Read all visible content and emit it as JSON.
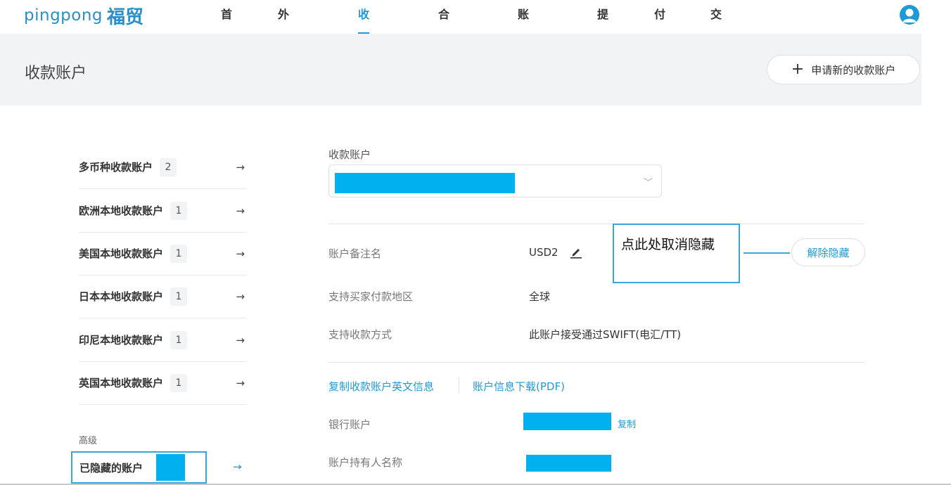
{
  "header": {
    "logo_en": "pingpong",
    "logo_cn": "福贸",
    "nav": [
      {
        "label": "首页"
      },
      {
        "label": "外贸收款"
      },
      {
        "label": "收款账户",
        "active": true
      },
      {
        "label": "合同订单"
      },
      {
        "label": "账单管理"
      },
      {
        "label": "提现"
      },
      {
        "label": "付款"
      },
      {
        "label": "交易查询"
      }
    ]
  },
  "page": {
    "title": "收款账户",
    "apply_button": "申请新的收款账户"
  },
  "sidebar": {
    "items": [
      {
        "label": "多币种收款账户",
        "count": "2"
      },
      {
        "label": "欧洲本地收款账户",
        "count": "1"
      },
      {
        "label": "美国本地收款账户",
        "count": "1"
      },
      {
        "label": "日本本地收款账户",
        "count": "1"
      },
      {
        "label": "印尼本地收款账户",
        "count": "1"
      },
      {
        "label": "英国本地收款账户",
        "count": "1"
      }
    ],
    "section_label": "高级",
    "hidden_accounts_label": "已隐藏的账户"
  },
  "detail": {
    "account_select_label": "收款账户",
    "remark_label": "账户备注名",
    "remark_value": "USD2",
    "unhide_button": "解除隐藏",
    "callout_text": "点此处取消隐藏",
    "region_label": "支持买家付款地区",
    "region_value": "全球",
    "method_label": "支持收款方式",
    "method_value": "此账户接受通过SWIFT(电汇/TT)",
    "copy_en_info_link": "复制收款账户英文信息",
    "download_pdf_link": "账户信息下载(PDF)",
    "bank_account_label": "银行账户",
    "copy_label": "复制",
    "holder_label": "账户持有人名称"
  },
  "colors": {
    "accent": "#1e9ad6",
    "redaction": "#00b0ef",
    "callout_border": "#3aa6dc"
  }
}
